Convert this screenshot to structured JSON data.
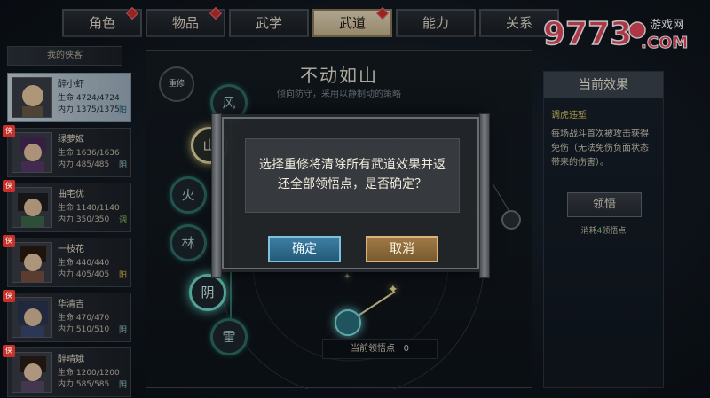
{
  "tabs": [
    {
      "label": "角色",
      "badge": true
    },
    {
      "label": "物品",
      "badge": true
    },
    {
      "label": "武学",
      "badge": false
    },
    {
      "label": "武道",
      "badge": true,
      "active": true
    },
    {
      "label": "能力",
      "badge": false
    },
    {
      "label": "关系",
      "badge": false
    }
  ],
  "logo": {
    "text": "9773",
    "suffix": "游戏网",
    "domain": ".COM"
  },
  "roster": {
    "label": "我的侠客",
    "characters": [
      {
        "name": "醉小虾",
        "hp": "生命 4724/4724",
        "mp": "内力 1375/1375",
        "attr": "阳",
        "pin": "",
        "selected": true
      },
      {
        "name": "绿萝姬",
        "hp": "生命 1636/1636",
        "mp": "内力 485/485",
        "attr": "阴",
        "pin": "侠",
        "selected": false
      },
      {
        "name": "曲宅优",
        "hp": "生命 1140/1140",
        "mp": "内力 350/350",
        "attr": "调",
        "pin": "侠",
        "selected": false
      },
      {
        "name": "一枝花",
        "hp": "生命 440/440",
        "mp": "内力 405/405",
        "attr": "阳",
        "pin": "侠",
        "selected": false
      },
      {
        "name": "华清吉",
        "hp": "生命 470/470",
        "mp": "内力 510/510",
        "attr": "阴",
        "pin": "侠",
        "selected": false
      },
      {
        "name": "醉晴娥",
        "hp": "生命 1200/1200",
        "mp": "内力 585/585",
        "attr": "阴",
        "pin": "侠",
        "selected": false
      }
    ]
  },
  "main": {
    "title": "不动如山",
    "subtitle": "倾向防守，采用以静制动的策略",
    "reset_label": "重修",
    "nodes": [
      "风",
      "山",
      "火",
      "林",
      "阴",
      "雷"
    ],
    "points_label": "当前领悟点",
    "points_value": "0"
  },
  "effect": {
    "panel_title": "当前效果",
    "name": "调虎违堑",
    "description": "每场战斗首次被攻击获得免伤（无法免伤负面状态带来的伤害）。",
    "learn_label": "领悟",
    "cost_prefix": "消耗",
    "cost_value": "4",
    "cost_suffix": "领悟点"
  },
  "dialog": {
    "message_line1": "选择重修将清除所有武道效果并返",
    "message_line2": "还全部领悟点，是否确定？",
    "confirm_label": "确定",
    "cancel_label": "取消"
  }
}
